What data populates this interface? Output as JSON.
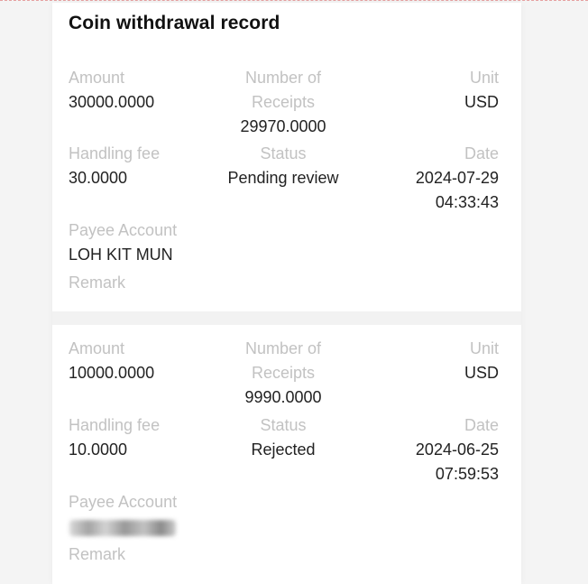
{
  "page": {
    "title": "Coin withdrawal record"
  },
  "labels": {
    "amount": "Amount",
    "receipts_line1": "Number of",
    "receipts_line2": "Receipts",
    "unit": "Unit",
    "handling_fee": "Handling fee",
    "status": "Status",
    "date": "Date",
    "payee_account": "Payee Account",
    "remark": "Remark"
  },
  "records": [
    {
      "amount": "30000.0000",
      "receipts": "29970.0000",
      "unit": "USD",
      "handling_fee": "30.0000",
      "status": "Pending review",
      "date": "2024-07-29",
      "time": "04:33:43",
      "payee_account": "LOH KIT MUN",
      "remark": ""
    },
    {
      "amount": "10000.0000",
      "receipts": "9990.0000",
      "unit": "USD",
      "handling_fee": "10.0000",
      "status": "Rejected",
      "date": "2024-06-25",
      "time": "07:59:53",
      "payee_account": null,
      "payee_account_redacted": true,
      "remark": ""
    }
  ],
  "colors": {
    "label": "#c2c2c2",
    "value": "#222222",
    "title": "#111111",
    "background": "#f4f4f4"
  }
}
